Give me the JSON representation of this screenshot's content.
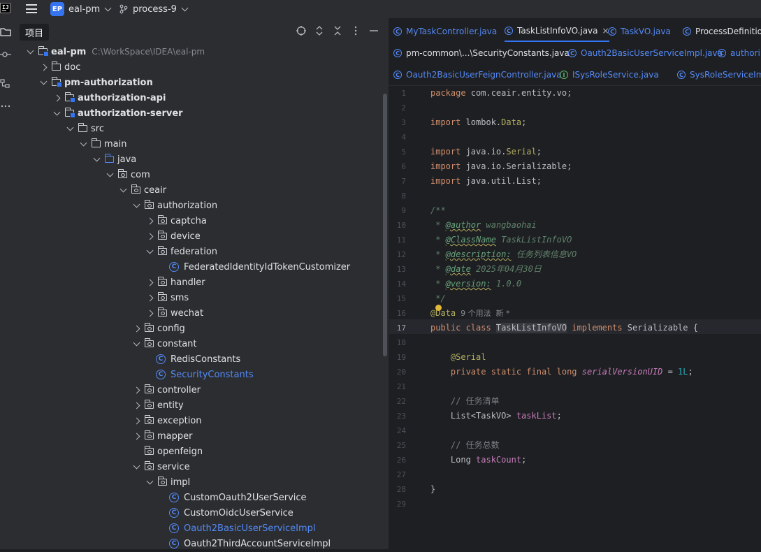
{
  "titlebar": {
    "project_badge": "EP",
    "project_name": "eal-pm",
    "branch": "process-9"
  },
  "project_panel": {
    "title": "项目"
  },
  "tree": [
    {
      "label": "eal-pm",
      "path": "C:\\WorkSpace\\IDEA\\eal-pm",
      "bold": true,
      "type": "module",
      "arrow": "down",
      "depth": 0
    },
    {
      "label": "doc",
      "type": "folder",
      "arrow": "right",
      "depth": 1
    },
    {
      "label": "pm-authorization",
      "bold": true,
      "type": "module",
      "arrow": "down",
      "depth": 1
    },
    {
      "label": "authorization-api",
      "bold": true,
      "type": "module",
      "arrow": "right",
      "depth": 2
    },
    {
      "label": "authorization-server",
      "bold": true,
      "type": "module",
      "arrow": "down",
      "depth": 2
    },
    {
      "label": "src",
      "type": "folder",
      "arrow": "down",
      "depth": 3
    },
    {
      "label": "main",
      "type": "folder",
      "arrow": "down",
      "depth": 4
    },
    {
      "label": "java",
      "type": "source",
      "arrow": "down",
      "depth": 5
    },
    {
      "label": "com",
      "type": "package",
      "arrow": "down",
      "depth": 6
    },
    {
      "label": "ceair",
      "type": "package",
      "arrow": "down",
      "depth": 7
    },
    {
      "label": "authorization",
      "type": "package",
      "arrow": "down",
      "depth": 8
    },
    {
      "label": "captcha",
      "type": "package",
      "arrow": "right",
      "depth": 9
    },
    {
      "label": "device",
      "type": "package",
      "arrow": "right",
      "depth": 9
    },
    {
      "label": "federation",
      "type": "package",
      "arrow": "down",
      "depth": 9
    },
    {
      "label": "FederatedIdentityIdTokenCustomizer",
      "type": "class",
      "arrow": "none",
      "depth": 10
    },
    {
      "label": "handler",
      "type": "package",
      "arrow": "right",
      "depth": 9
    },
    {
      "label": "sms",
      "type": "package",
      "arrow": "right",
      "depth": 9
    },
    {
      "label": "wechat",
      "type": "package",
      "arrow": "right",
      "depth": 9
    },
    {
      "label": "config",
      "type": "package",
      "arrow": "right",
      "depth": 8
    },
    {
      "label": "constant",
      "type": "package",
      "arrow": "down",
      "depth": 8
    },
    {
      "label": "RedisConstants",
      "type": "class",
      "arrow": "none",
      "depth": 9
    },
    {
      "label": "SecurityConstants",
      "type": "class",
      "arrow": "none",
      "depth": 9,
      "highlight": true
    },
    {
      "label": "controller",
      "type": "package",
      "arrow": "right",
      "depth": 8
    },
    {
      "label": "entity",
      "type": "package",
      "arrow": "right",
      "depth": 8
    },
    {
      "label": "exception",
      "type": "package",
      "arrow": "right",
      "depth": 8
    },
    {
      "label": "mapper",
      "type": "package",
      "arrow": "right",
      "depth": 8
    },
    {
      "label": "openfeign",
      "type": "package",
      "arrow": "none",
      "depth": 8
    },
    {
      "label": "service",
      "type": "package",
      "arrow": "down",
      "depth": 8
    },
    {
      "label": "impl",
      "type": "package",
      "arrow": "down",
      "depth": 9
    },
    {
      "label": "CustomOauth2UserService",
      "type": "class",
      "arrow": "none",
      "depth": 10
    },
    {
      "label": "CustomOidcUserService",
      "type": "class",
      "arrow": "none",
      "depth": 10
    },
    {
      "label": "Oauth2BasicUserServiceImpl",
      "type": "class",
      "arrow": "none",
      "depth": 10,
      "highlight": true
    },
    {
      "label": "Oauth2ThirdAccountServiceImpl",
      "type": "class",
      "arrow": "none",
      "depth": 10
    }
  ],
  "tabs": {
    "row1": [
      {
        "label": "MyTaskController.java",
        "icon": "C",
        "active": false
      },
      {
        "label": "TaskListInfoVO.java",
        "icon": "C",
        "active": true
      },
      {
        "label": "TaskVO.java",
        "icon": "C",
        "active": false
      },
      {
        "label": "ProcessDefinition",
        "icon": "C",
        "active": false,
        "plain": true
      }
    ],
    "row2": [
      {
        "label": "pm-common\\...\\SecurityConstants.java",
        "icon": "C",
        "plain": true
      },
      {
        "label": "Oauth2BasicUserServiceImpl.java",
        "icon": "C"
      },
      {
        "label": "authori",
        "icon": "C"
      }
    ],
    "row3": [
      {
        "label": "Oauth2BasicUserFeignController.java",
        "icon": "C"
      },
      {
        "label": "ISysRoleService.java",
        "icon": "I"
      },
      {
        "label": "SysRoleServiceImpl.java",
        "icon": "C"
      }
    ],
    "close_glyph": "×"
  },
  "code": {
    "current_line": 17,
    "line_numbers": [
      "1",
      "2",
      "3",
      "4",
      "5",
      "6",
      "7",
      "8",
      "9",
      "10",
      "11",
      "12",
      "13",
      "14",
      "15",
      "16",
      "17",
      "18",
      "19",
      "20",
      "21",
      "22",
      "23",
      "24",
      "25",
      "26",
      "27",
      "28",
      "29"
    ],
    "lines": [
      [
        {
          "t": "package ",
          "c": "kw"
        },
        {
          "t": "com.ceair.entity.vo;",
          "c": ""
        }
      ],
      [],
      [
        {
          "t": "import ",
          "c": "kw"
        },
        {
          "t": "lombok.",
          "c": ""
        },
        {
          "t": "Data",
          "c": "ann"
        },
        {
          "t": ";",
          "c": ""
        }
      ],
      [],
      [
        {
          "t": "import ",
          "c": "kw"
        },
        {
          "t": "java.io.",
          "c": ""
        },
        {
          "t": "Serial",
          "c": "ann"
        },
        {
          "t": ";",
          "c": ""
        }
      ],
      [
        {
          "t": "import ",
          "c": "kw"
        },
        {
          "t": "java.io.Serializable;",
          "c": ""
        }
      ],
      [
        {
          "t": "import ",
          "c": "kw"
        },
        {
          "t": "java.util.List;",
          "c": ""
        }
      ],
      [],
      [
        {
          "t": "/**",
          "c": "doc"
        }
      ],
      [
        {
          "t": " * ",
          "c": "doc"
        },
        {
          "t": "@author",
          "c": "doctag"
        },
        {
          "t": " wangbaohai",
          "c": "doc"
        }
      ],
      [
        {
          "t": " * ",
          "c": "doc"
        },
        {
          "t": "@ClassName",
          "c": "doctag"
        },
        {
          "t": " TaskListInfoVO",
          "c": "doc"
        }
      ],
      [
        {
          "t": " * ",
          "c": "doc"
        },
        {
          "t": "@description:",
          "c": "doctag"
        },
        {
          "t": " 任务列表信息VO",
          "c": "doc"
        }
      ],
      [
        {
          "t": " * ",
          "c": "doc"
        },
        {
          "t": "@date",
          "c": "doctag"
        },
        {
          "t": " 2025年04月30日",
          "c": "doc"
        }
      ],
      [
        {
          "t": " * ",
          "c": "doc"
        },
        {
          "t": "@version:",
          "c": "doctag"
        },
        {
          "t": " 1.0.0",
          "c": "doc"
        }
      ],
      [
        {
          "t": " */",
          "c": "doc"
        }
      ],
      [
        {
          "t": "@Data",
          "c": "ann"
        },
        {
          "t": "  9 个用法  新 *",
          "c": "hint"
        }
      ],
      [
        {
          "t": "public class ",
          "c": "kw"
        },
        {
          "t": "TaskListInfoVO",
          "c": "cls-hl"
        },
        {
          "t": " ",
          "c": ""
        },
        {
          "t": "implements ",
          "c": "kw"
        },
        {
          "t": "Serializable {",
          "c": ""
        }
      ],
      [],
      [
        {
          "t": "    ",
          "c": ""
        },
        {
          "t": "@Serial",
          "c": "ann"
        }
      ],
      [
        {
          "t": "    ",
          "c": ""
        },
        {
          "t": "private static final long ",
          "c": "kw"
        },
        {
          "t": "serialVersionUID",
          "c": "sfld"
        },
        {
          "t": " = ",
          "c": ""
        },
        {
          "t": "1L",
          "c": "num"
        },
        {
          "t": ";",
          "c": ""
        }
      ],
      [],
      [
        {
          "t": "    // 任务清单",
          "c": "com"
        }
      ],
      [
        {
          "t": "    List<TaskVO> ",
          "c": ""
        },
        {
          "t": "taskList",
          "c": "fld"
        },
        {
          "t": ";",
          "c": ""
        }
      ],
      [],
      [
        {
          "t": "    // 任务总数",
          "c": "com"
        }
      ],
      [
        {
          "t": "    Long ",
          "c": ""
        },
        {
          "t": "taskCount",
          "c": "fld"
        },
        {
          "t": ";",
          "c": ""
        }
      ],
      [],
      [
        {
          "t": "}",
          "c": ""
        }
      ],
      []
    ]
  },
  "icons": {
    "menu": "hamburger-icon",
    "branch": "git-branch-icon",
    "locate": "crosshair-icon",
    "expand": "expand-all-icon",
    "collapse": "collapse-all-icon",
    "options": "more-vertical-icon",
    "hide": "minimize-icon"
  }
}
